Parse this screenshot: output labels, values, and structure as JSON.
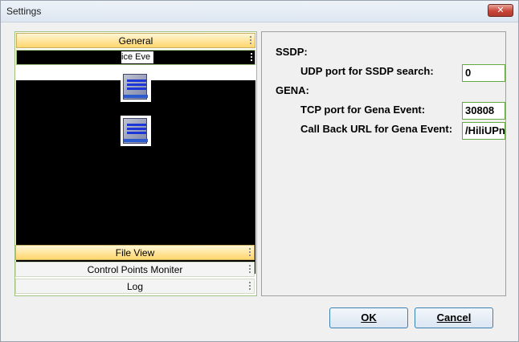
{
  "window": {
    "title": "Settings",
    "close_glyph": "✕"
  },
  "left_panel": {
    "sections": [
      {
        "label": "General",
        "active": true
      },
      {
        "label": "File View",
        "active": false
      },
      {
        "label": "Control Points Moniter",
        "active": false
      },
      {
        "label": "Log",
        "active": false
      }
    ],
    "general_sub_label": "ice Eve",
    "icons": [
      "document-list-icon",
      "document-list-icon"
    ]
  },
  "form": {
    "ssdp_heading": "SSDP:",
    "udp_label": "UDP port for SSDP search:",
    "udp_value": "0",
    "gena_heading": "GENA:",
    "tcp_label": "TCP port for Gena Event:",
    "tcp_value": "30808",
    "callback_label": "Call Back URL for Gena Event:",
    "callback_value": "/HiliUPn"
  },
  "buttons": {
    "ok": "OK",
    "cancel": "Cancel"
  },
  "colors": {
    "active_header": "#ffd66b",
    "input_border": "#66a93f",
    "panel_bg": "#f0f0f0"
  }
}
